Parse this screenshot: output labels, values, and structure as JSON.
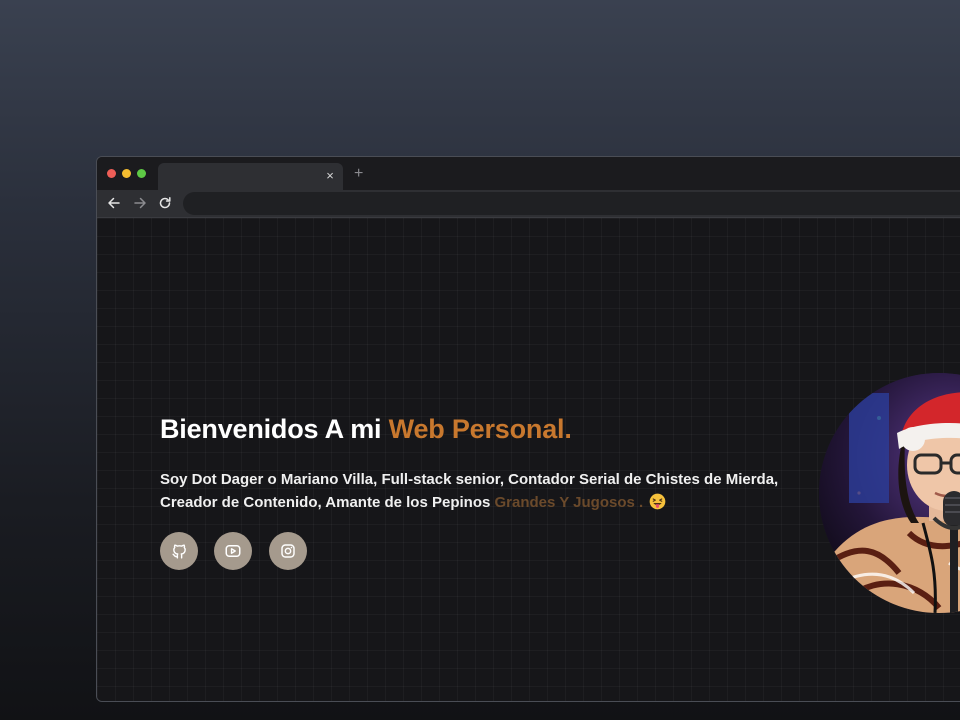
{
  "browser": {
    "tab_close": "×",
    "new_tab": "+"
  },
  "hero": {
    "title_prefix": "Bienvenidos A mi ",
    "title_accent": "Web Personal.",
    "desc_main": "Soy Dot Dager o Mariano Villa, Full-stack senior, Contador Serial de Chistes de Mierda, Creador de Contenido, Amante de los Pepinos ",
    "desc_muted": "Grandes Y Jugosos .",
    "accent_color": "#c8782e"
  },
  "socials": [
    {
      "icon": "github-icon"
    },
    {
      "icon": "youtube-icon"
    },
    {
      "icon": "instagram-icon"
    }
  ]
}
